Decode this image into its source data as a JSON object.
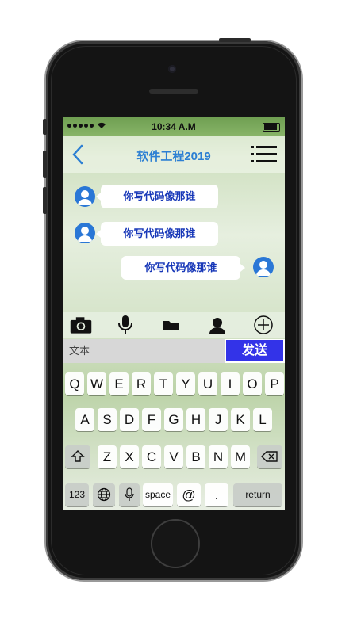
{
  "status_bar": {
    "time": "10:34 A.M"
  },
  "header": {
    "title": "软件工程2019"
  },
  "messages": [
    {
      "side": "left",
      "text": "你写代码像那谁"
    },
    {
      "side": "left",
      "text": "你写代码像那谁"
    },
    {
      "side": "right",
      "text": "你写代码像那谁"
    }
  ],
  "toolbar": {
    "icons": [
      "camera-icon",
      "microphone-icon",
      "folder-icon",
      "contact-icon",
      "add-icon"
    ]
  },
  "input": {
    "value": "文本",
    "send_label": "发送"
  },
  "keyboard": {
    "row1": [
      "Q",
      "W",
      "E",
      "R",
      "T",
      "Y",
      "U",
      "I",
      "O",
      "P"
    ],
    "row2": [
      "A",
      "S",
      "D",
      "F",
      "G",
      "H",
      "J",
      "K",
      "L"
    ],
    "row3": [
      "Z",
      "X",
      "C",
      "V",
      "B",
      "N",
      "M"
    ],
    "numbers_label": "123",
    "space_label": "space",
    "at_label": "@",
    "dot_label": ".",
    "return_label": "return"
  },
  "colors": {
    "accent": "#2c7fd3",
    "send": "#3333e8",
    "bubble_text": "#1838b8"
  }
}
